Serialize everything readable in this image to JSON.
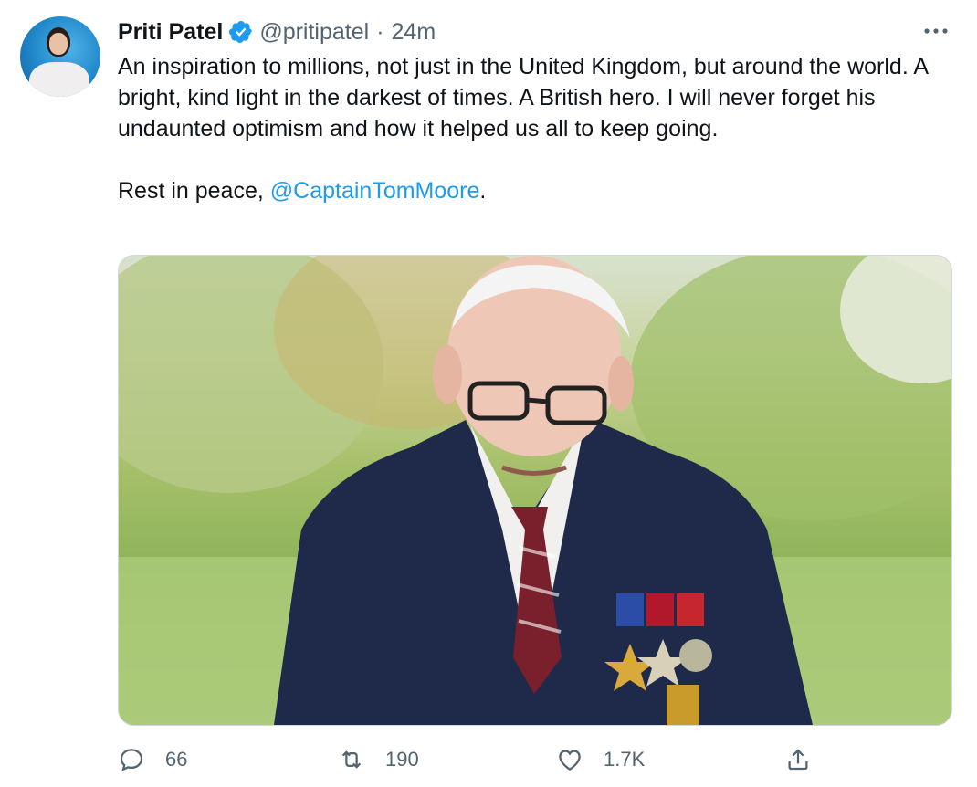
{
  "author": {
    "name": "Priti Patel",
    "handle": "@pritipatel",
    "separator": "·",
    "time": "24m",
    "verified": true
  },
  "tweet": {
    "paragraph1": "An inspiration to millions, not just in the United Kingdom, but around the world. A bright, kind light in the darkest of times. A British hero. I will never forget his undaunted optimism and how it helped us all to keep going.",
    "paragraph2_prefix": "Rest in peace, ",
    "mention": "@CaptainTomMoore",
    "paragraph2_suffix": "."
  },
  "actions": {
    "replies": "66",
    "retweets": "190",
    "likes": "1.7K"
  },
  "icons": {
    "more": "more-icon",
    "verified": "verified-badge-icon",
    "reply": "reply-icon",
    "retweet": "retweet-icon",
    "like": "heart-icon",
    "share": "share-icon"
  },
  "colors": {
    "accent": "#1d9bf0",
    "secondary_text": "#536471",
    "text": "#0f1419"
  }
}
